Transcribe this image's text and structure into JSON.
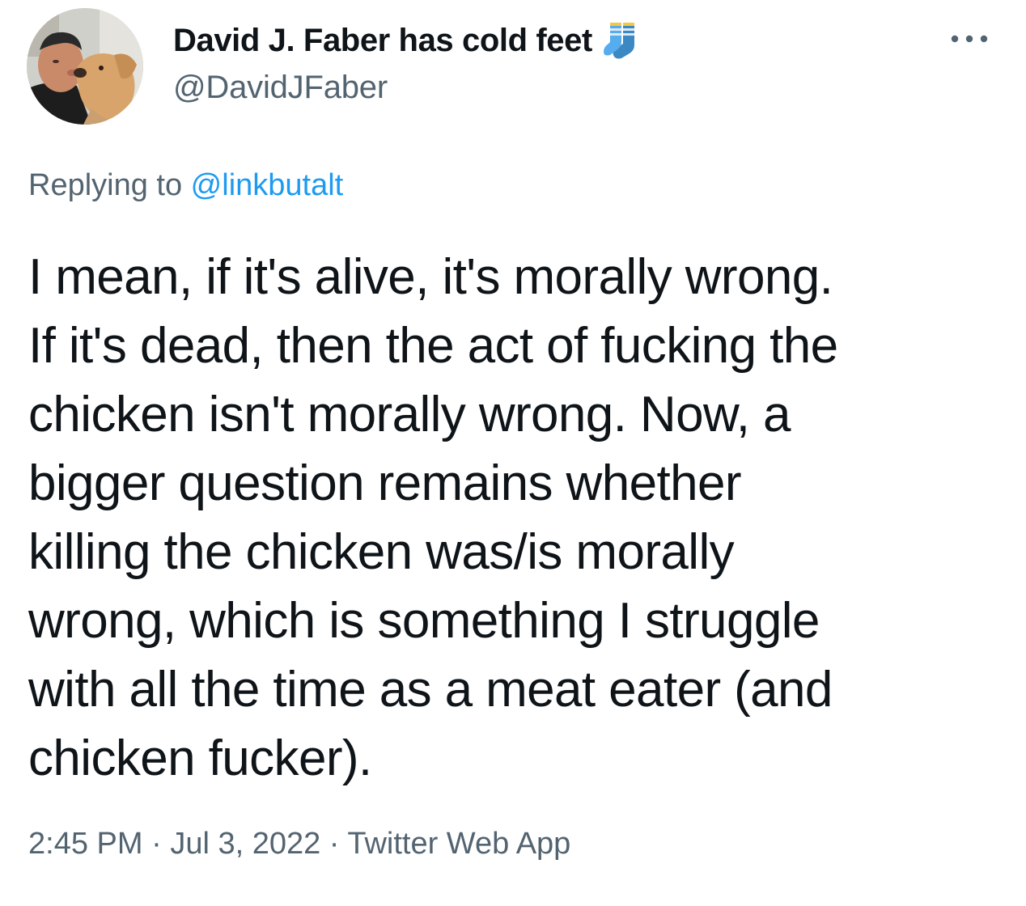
{
  "author": {
    "display_name": "David J. Faber has cold feet",
    "emoji": "socks-icon",
    "handle": "@DavidJFaber"
  },
  "more_menu_icon": "more-horizontal-icon",
  "reply": {
    "prefix": "Replying to ",
    "mention": "@linkbutalt"
  },
  "tweet": {
    "text": "I mean, if it's alive, it's morally wrong.\nIf it's dead, then the act of fucking the\nchicken isn't morally wrong. Now, a\nbigger question remains whether\nkilling the chicken was/is morally\nwrong, which is something I struggle\nwith all the time as a meat eater (and\nchicken fucker)."
  },
  "meta": {
    "time": "2:45 PM",
    "separator": " · ",
    "date": "Jul 3, 2022",
    "source": "Twitter Web App"
  },
  "colors": {
    "text_primary": "#0f1419",
    "text_secondary": "#536471",
    "accent": "#1d9bf0",
    "background": "#ffffff"
  }
}
